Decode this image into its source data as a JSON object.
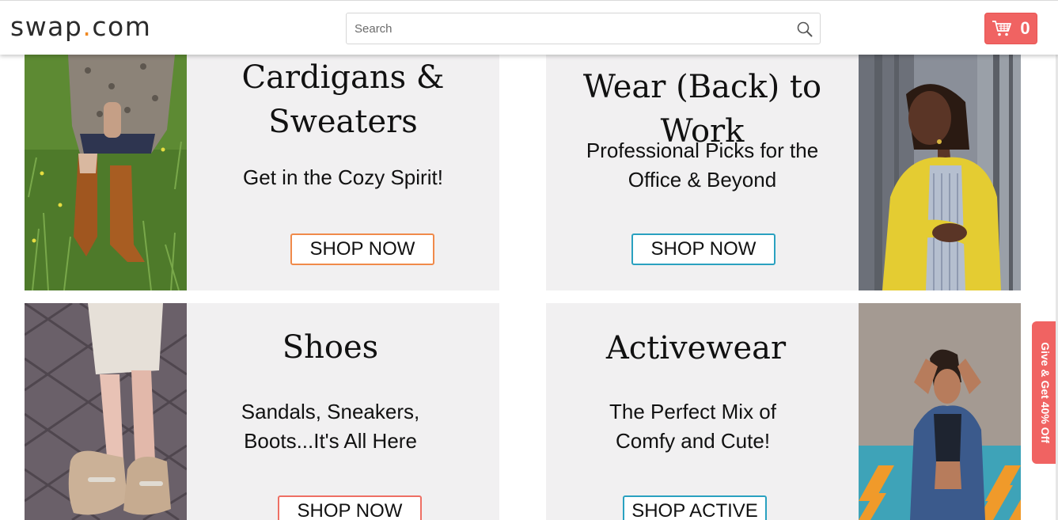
{
  "header": {
    "logo_before": "swap",
    "logo_dot": ".",
    "logo_after": "com",
    "search_placeholder": "Search",
    "search_icon": "search-icon",
    "cart_icon": "cart-icon",
    "cart_count": "0"
  },
  "cards": [
    {
      "title_line1": "Cardigans &",
      "title_line2": "Sweaters",
      "subtitle_line1": "Get in the Cozy Spirit!",
      "button": "SHOP NOW",
      "button_color": "#f08a4a"
    },
    {
      "title_line1": "Wear (Back) to Work",
      "subtitle_line1": "Professional Picks for the",
      "subtitle_line2": "Office & Beyond",
      "button": "SHOP NOW",
      "button_color": "#2aa1c0"
    },
    {
      "title_line1": "Shoes",
      "subtitle_line1": "Sandals, Sneakers,",
      "subtitle_line2": "Boots...It's All Here",
      "button": "SHOP NOW",
      "button_color": "#ee6f64"
    },
    {
      "title_line1": "Activewear",
      "subtitle_line1": "The Perfect Mix of",
      "subtitle_line2": "Comfy and Cute!",
      "button": "SHOP ACTIVE",
      "button_color": "#2aa1c0"
    }
  ],
  "side_tab": {
    "label": "Give & Get 40% Off"
  },
  "colors": {
    "brand_coral": "#f06362",
    "accent_orange": "#f08a24",
    "card_bg": "#f1f0f1"
  }
}
